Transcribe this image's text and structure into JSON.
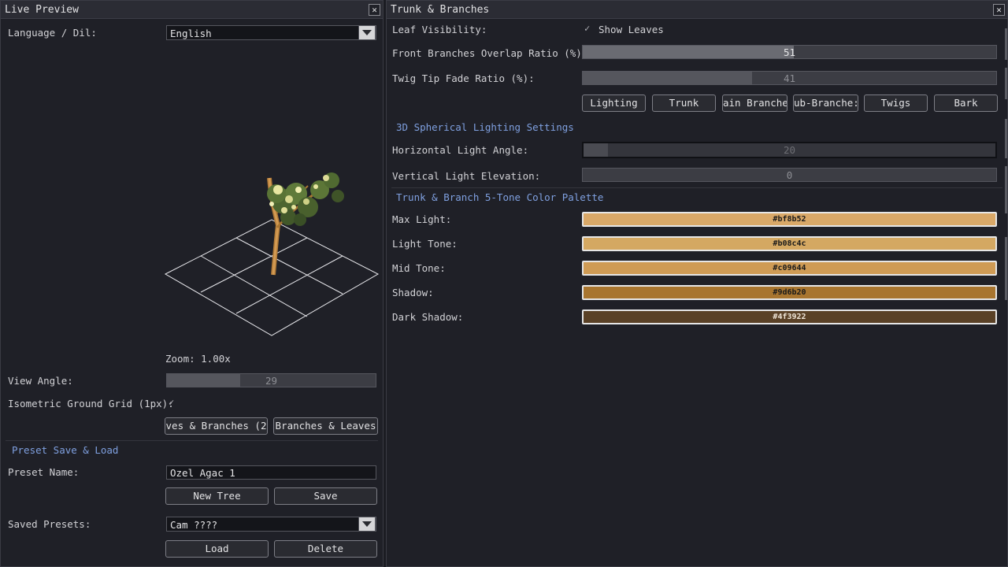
{
  "left": {
    "title": "Live Preview",
    "language_label": "Language / Dil:",
    "language_value": "English",
    "zoom_text": "Zoom: 1.00x",
    "view_angle_label": "View Angle:",
    "view_angle_value": "29",
    "view_angle_fraction": 0.35,
    "grid_label": "Isometric Ground Grid (1px):",
    "grid_check": "✓",
    "view_btn_1": "ves & Branches (2",
    "view_btn_2": "Branches & Leaves",
    "preset_section": "Preset Save & Load",
    "preset_name_label": "Preset Name:",
    "preset_name_value": "Ozel Agac 1",
    "new_tree": "New Tree",
    "save": "Save",
    "saved_presets_label": "Saved Presets:",
    "saved_presets_value": "Cam ????",
    "load": "Load",
    "delete": "Delete"
  },
  "right": {
    "title": "Trunk & Branches",
    "leaf_visibility_label": "Leaf Visibility:",
    "show_leaves_check": "✓",
    "show_leaves_label": "Show Leaves",
    "front_overlap_label": "Front Branches Overlap Ratio (%):",
    "front_overlap_value": "51",
    "front_overlap_fraction": 0.51,
    "twig_fade_label": "Twig Tip Fade Ratio (%):",
    "twig_fade_value": "41",
    "twig_fade_fraction": 0.41,
    "tabs": [
      "Lighting",
      "Trunk",
      "ain Branche",
      "ub-Branche:",
      "Twigs",
      "Bark"
    ],
    "lighting_section": "3D Spherical Lighting Settings",
    "h_angle_label": "Horizontal Light Angle:",
    "h_angle_value": "20",
    "h_angle_fraction": 0.06,
    "v_elev_label": "Vertical Light Elevation:",
    "v_elev_value": "0",
    "v_elev_fraction": 0.0,
    "palette_section": "Trunk & Branch 5-Tone Color Palette",
    "palette": [
      {
        "label": "Max Light:",
        "hex": "#bf8b52",
        "color": "#d9a868"
      },
      {
        "label": "Light Tone:",
        "hex": "#b08c4c",
        "color": "#d4a862"
      },
      {
        "label": "Mid Tone:",
        "hex": "#c09644",
        "color": "#cf9b55"
      },
      {
        "label": "Shadow:",
        "hex": "#9d6b20",
        "color": "#a8752f"
      },
      {
        "label": "Dark Shadow:",
        "hex": "#4f3922",
        "color": "#5a4126"
      }
    ]
  },
  "colors": {
    "accent_section": "#7fa0e0",
    "trunk": "#c98f45",
    "leaf_light": "#e8e6a0",
    "leaf_dark": "#5f7a3a"
  }
}
